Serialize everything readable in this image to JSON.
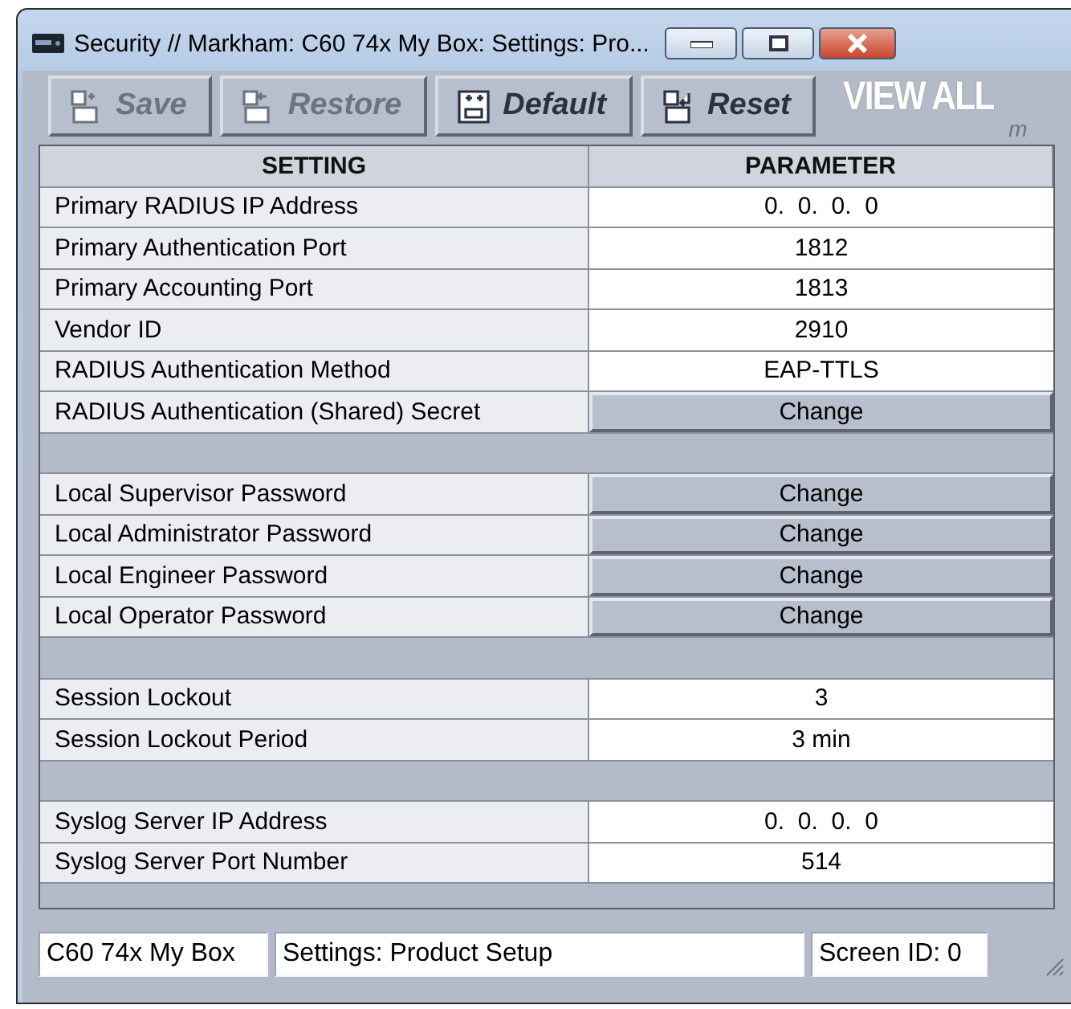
{
  "window": {
    "title": "Security // Markham: C60 74x My Box: Settings: Pro..."
  },
  "toolbar": {
    "buttons": [
      {
        "label": "Save",
        "kind": "save",
        "disabled": true
      },
      {
        "label": "Restore",
        "kind": "restore",
        "disabled": true
      },
      {
        "label": "Default",
        "kind": "default",
        "disabled": false
      },
      {
        "label": "Reset",
        "kind": "reset",
        "disabled": false
      }
    ],
    "logo": {
      "text": "VIEW ALL",
      "subtext": "m"
    }
  },
  "table": {
    "columns": [
      "SETTING",
      "PARAMETER"
    ],
    "rows": [
      {
        "kind": "value",
        "setting": "Primary RADIUS IP Address",
        "parameter": "0.  0.  0.  0"
      },
      {
        "kind": "value",
        "setting": "Primary Authentication Port",
        "parameter": "1812"
      },
      {
        "kind": "value",
        "setting": "Primary Accounting Port",
        "parameter": "1813"
      },
      {
        "kind": "value",
        "setting": "Vendor ID",
        "parameter": "2910"
      },
      {
        "kind": "value",
        "setting": "RADIUS Authentication Method",
        "parameter": "EAP-TTLS"
      },
      {
        "kind": "button",
        "setting": "RADIUS Authentication (Shared) Secret",
        "parameter": "Change"
      },
      {
        "kind": "spacer"
      },
      {
        "kind": "button",
        "setting": "Local Supervisor Password",
        "parameter": "Change"
      },
      {
        "kind": "button",
        "setting": "Local Administrator Password",
        "parameter": "Change"
      },
      {
        "kind": "button",
        "setting": "Local Engineer Password",
        "parameter": "Change"
      },
      {
        "kind": "button",
        "setting": "Local Operator Password",
        "parameter": "Change"
      },
      {
        "kind": "spacer"
      },
      {
        "kind": "value",
        "setting": "Session Lockout",
        "parameter": "3"
      },
      {
        "kind": "value",
        "setting": "Session Lockout Period",
        "parameter": "3 min"
      },
      {
        "kind": "spacer"
      },
      {
        "kind": "value",
        "setting": "Syslog Server IP Address",
        "parameter": "0.  0.  0.  0"
      },
      {
        "kind": "value",
        "setting": "Syslog Server Port Number",
        "parameter": "514"
      }
    ]
  },
  "status_bar": [
    "C60 74x My Box",
    "Settings: Product Setup",
    "Screen ID: 0"
  ]
}
